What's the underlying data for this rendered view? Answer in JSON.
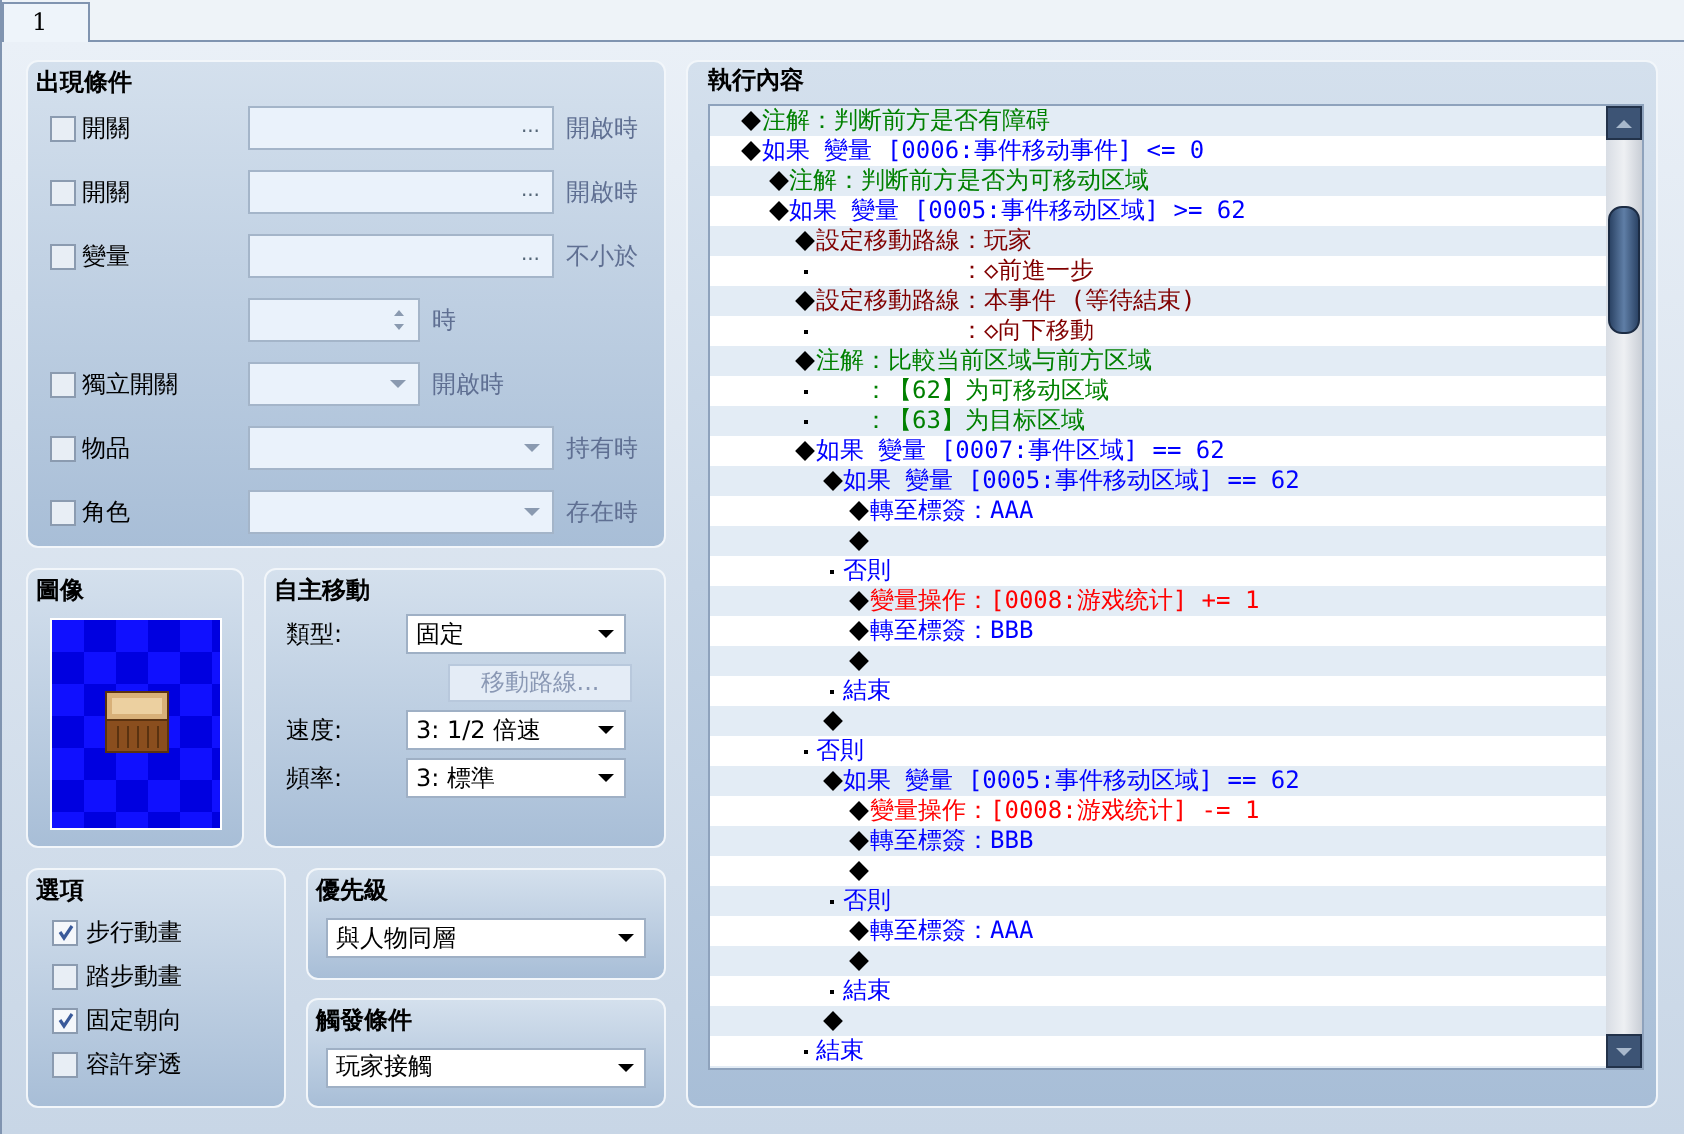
{
  "tab": {
    "label": "1",
    "selected": true
  },
  "conditions": {
    "title": "出現條件",
    "rows": [
      {
        "kind": "picker",
        "label": "開關",
        "checked": false,
        "button": "...",
        "suffix": "開啟時"
      },
      {
        "kind": "picker",
        "label": "開關",
        "checked": false,
        "button": "...",
        "suffix": "開啟時"
      },
      {
        "kind": "picker",
        "label": "變量",
        "checked": false,
        "button": "...",
        "suffix": "不小於"
      },
      {
        "kind": "spinner",
        "suffix": "時"
      },
      {
        "kind": "short-dropdown",
        "label": "獨立開關",
        "checked": false,
        "suffix": "開啟時"
      },
      {
        "kind": "dropdown",
        "label": "物品",
        "checked": false,
        "suffix": "持有時"
      },
      {
        "kind": "dropdown",
        "label": "角色",
        "checked": false,
        "suffix": "存在時"
      }
    ]
  },
  "graphic": {
    "title": "圖像"
  },
  "autonomous": {
    "title": "自主移動",
    "type": {
      "label": "類型:",
      "value": "固定"
    },
    "route_button": {
      "label": "移動路線...",
      "disabled": true
    },
    "speed": {
      "label": "速度:",
      "value": "3: 1/2 倍速"
    },
    "frequency": {
      "label": "頻率:",
      "value": "3: 標準"
    }
  },
  "options": {
    "title": "選項",
    "items": [
      {
        "label": "步行動畫",
        "checked": true
      },
      {
        "label": "踏步動畫",
        "checked": false
      },
      {
        "label": "固定朝向",
        "checked": true
      },
      {
        "label": "容許穿透",
        "checked": false
      }
    ]
  },
  "priority": {
    "title": "優先級",
    "value": "與人物同層"
  },
  "trigger": {
    "title": "觸發條件",
    "value": "玩家接觸"
  },
  "contents": {
    "title": "執行內容",
    "commands": [
      {
        "kind": "command",
        "label": "注解",
        "text": "：判断前方是否有障碍",
        "color": "#008000"
      },
      {
        "kind": "command",
        "text": "如果 變量 [0006:事件移动事件] <= 0",
        "color": "#0000ff",
        "children": [
          {
            "kind": "command",
            "label": "注解",
            "text": "：判断前方是否为可移动区域",
            "color": "#008000"
          },
          {
            "kind": "command",
            "text": "如果 變量 [0005:事件移动区域] >= 62",
            "color": "#0000ff",
            "children": [
              {
                "kind": "command",
                "label": "設定移動路線",
                "text": "：玩家",
                "color": "#800000",
                "continued": [
                  "：◇前進一步"
                ]
              },
              {
                "kind": "command",
                "label": "設定移動路線",
                "text": "：本事件 (等待結束)",
                "color": "#800000",
                "continued": [
                  "：◇向下移動"
                ]
              },
              {
                "kind": "command",
                "label": "注解",
                "text": "：比較当前区域与前方区域",
                "color": "#008000",
                "continued": [
                  "：【62】为可移动区域",
                  "：【63】为目标区域"
                ]
              },
              {
                "kind": "command",
                "text": "如果 變量 [0007:事件区域] == 62",
                "color": "#0000ff",
                "children": [
                  {
                    "kind": "command",
                    "text": "如果 變量 [0005:事件移动区域] == 62",
                    "color": "#0000ff",
                    "children": [
                      {
                        "kind": "command",
                        "label": "轉至標簽",
                        "text": "：AAA",
                        "color": "#0000ff"
                      },
                      {
                        "kind": "command"
                      }
                    ]
                  },
                  {
                    "kind": "branch",
                    "text": "否則",
                    "color": "#0000ff",
                    "children": [
                      {
                        "kind": "command",
                        "label": "變量操作",
                        "text": "：[0008:游戏统计] += 1",
                        "color": "#ff0000"
                      },
                      {
                        "kind": "command",
                        "label": "轉至標簽",
                        "text": "：BBB",
                        "color": "#0000ff"
                      },
                      {
                        "kind": "command"
                      }
                    ]
                  },
                  {
                    "kind": "branch",
                    "text": "結束",
                    "color": "#0000ff"
                  },
                  {
                    "kind": "command"
                  }
                ]
              },
              {
                "kind": "branch",
                "text": "否則",
                "color": "#0000ff",
                "children": [
                  {
                    "kind": "command",
                    "text": "如果 變量 [0005:事件移动区域] == 62",
                    "color": "#0000ff",
                    "children": [
                      {
                        "kind": "command",
                        "label": "變量操作",
                        "text": "：[0008:游戏统计] -= 1",
                        "color": "#ff0000"
                      },
                      {
                        "kind": "command",
                        "label": "轉至標簽",
                        "text": "：BBB",
                        "color": "#0000ff"
                      },
                      {
                        "kind": "command"
                      }
                    ]
                  },
                  {
                    "kind": "branch",
                    "text": "否則",
                    "color": "#0000ff",
                    "children": [
                      {
                        "kind": "command",
                        "label": "轉至標簽",
                        "text": "：AAA",
                        "color": "#0000ff"
                      },
                      {
                        "kind": "command"
                      }
                    ]
                  },
                  {
                    "kind": "branch",
                    "text": "結束",
                    "color": "#0000ff"
                  },
                  {
                    "kind": "command"
                  }
                ]
              },
              {
                "kind": "branch",
                "text": "結束",
                "color": "#0000ff"
              }
            ]
          }
        ]
      }
    ]
  }
}
